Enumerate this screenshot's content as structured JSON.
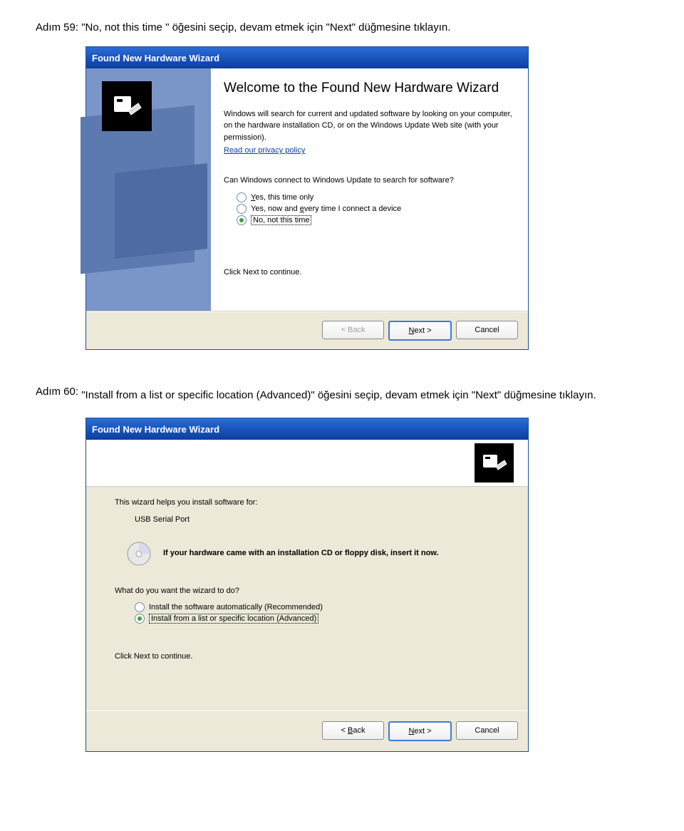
{
  "step59": {
    "label": "Adım 59:",
    "text": "\"No, not this time \" öğesini seçip, devam etmek için \"Next\" düğmesine tıklayın."
  },
  "step60": {
    "label": "Adım 60:",
    "text": "\"Install from a list or specific location (Advanced)\" öğesini seçip, devam etmek için \"Next\" düğmesine tıklayın."
  },
  "dialog1": {
    "title": "Found New Hardware Wizard",
    "heading": "Welcome to the Found New Hardware Wizard",
    "intro": "Windows will search for current and updated software by looking on your computer, on the hardware installation CD, or on the Windows Update Web site (with your permission).",
    "privacy_link": "Read our privacy policy",
    "question": "Can Windows connect to Windows Update to search for software?",
    "radios": {
      "opt1": "Yes, this time only",
      "opt2": "Yes, now and every time I connect a device",
      "opt3": "No, not this time"
    },
    "continue": "Click Next to continue.",
    "buttons": {
      "back": "< Back",
      "next": "Next >",
      "cancel": "Cancel"
    }
  },
  "dialog2": {
    "title": "Found New Hardware Wizard",
    "help_text": "This wizard helps you install software for:",
    "device": "USB Serial Port",
    "cd_text": "If your hardware came with an installation CD or floppy disk, insert it now.",
    "question": "What do you want the wizard to do?",
    "radios": {
      "opt1": "Install the software automatically (Recommended)",
      "opt2": "Install from a list or specific location (Advanced)"
    },
    "continue": "Click Next to continue.",
    "buttons": {
      "back": "< Back",
      "next": "Next >",
      "cancel": "Cancel"
    }
  }
}
